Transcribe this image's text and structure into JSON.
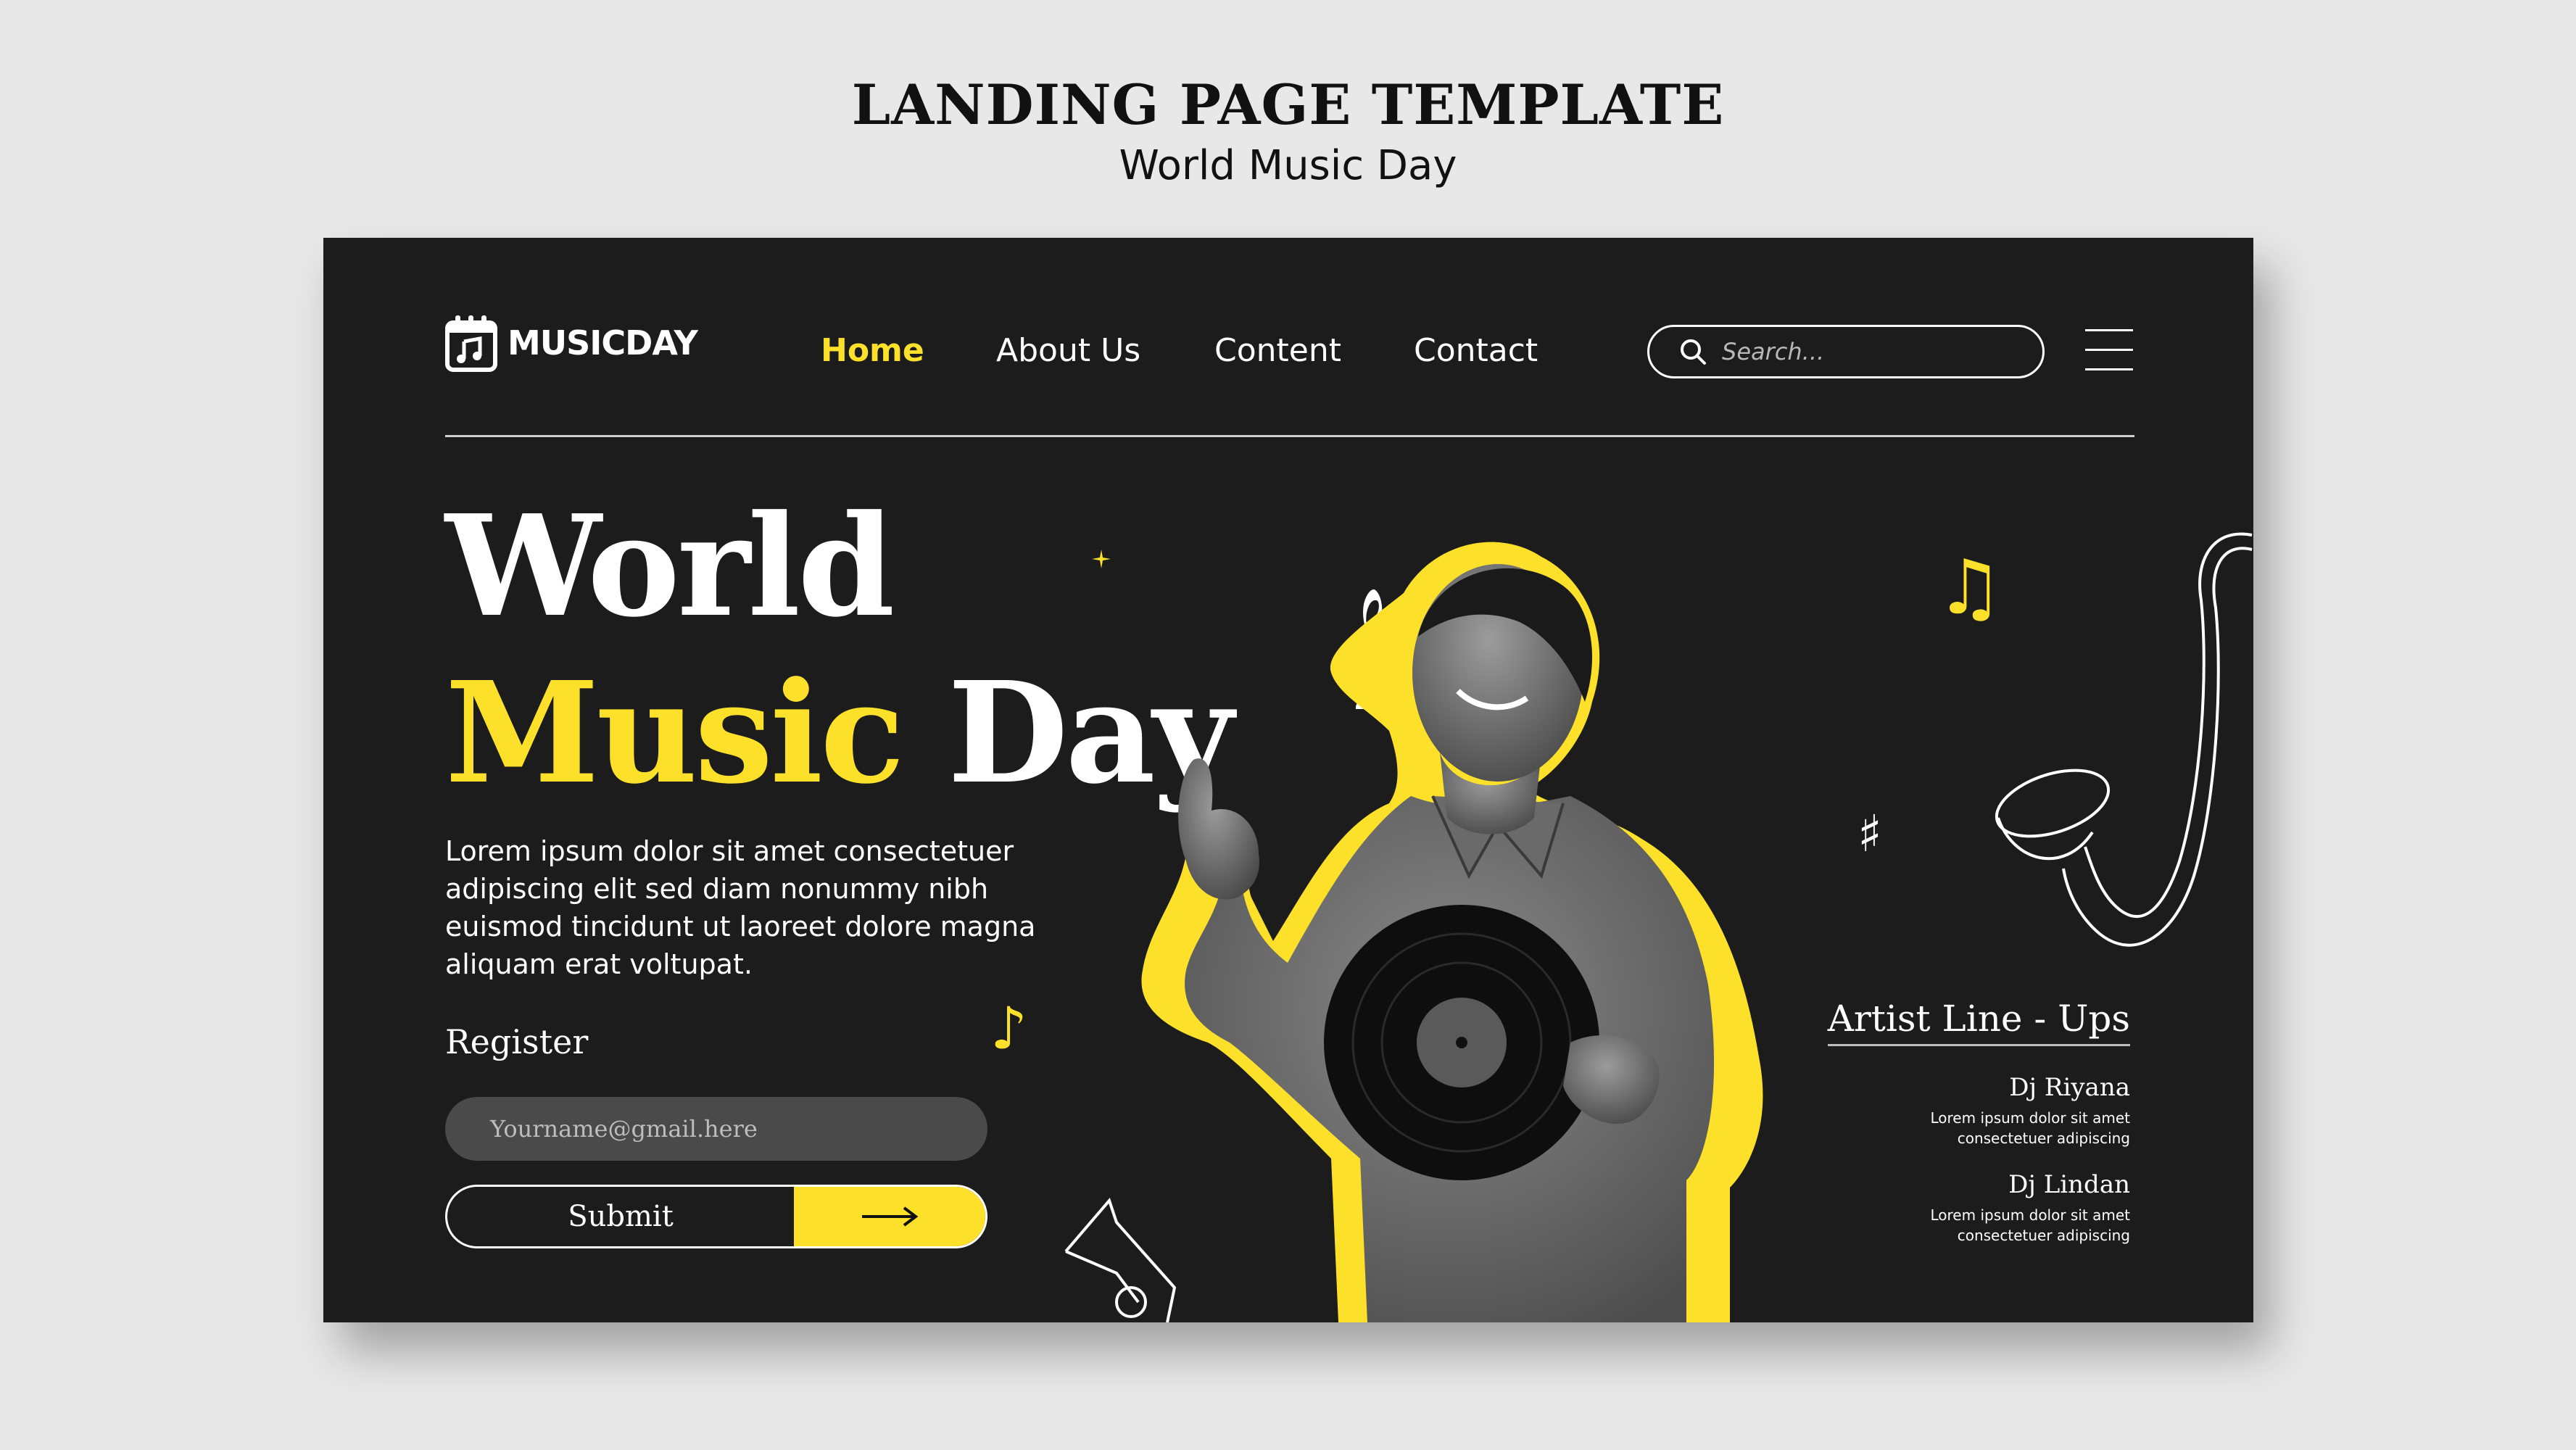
{
  "header": {
    "title": "LANDING PAGE TEMPLATE",
    "subtitle": "World Music Day"
  },
  "brand": {
    "logo_text": "MUSICDAY",
    "icon": "calendar-music-icon"
  },
  "nav": {
    "items": [
      {
        "label": "Home",
        "active": true
      },
      {
        "label": "About Us"
      },
      {
        "label": "Content"
      },
      {
        "label": "Contact"
      }
    ]
  },
  "search": {
    "placeholder": "Search..."
  },
  "hero": {
    "line1": "World",
    "line2_highlight": "Music",
    "line2_rest": "Day",
    "lead": "Lorem ipsum dolor sit amet consectetuer adipiscing elit sed diam nonummy nibh euismod tincidunt ut laoreet dolore magna aliquam erat voltupat."
  },
  "register": {
    "label": "Register",
    "email_placeholder": "Yourname@gmail.here",
    "submit_label": "Submit"
  },
  "artists": {
    "title": "Artist Line - Ups",
    "items": [
      {
        "name": "Dj Riyana",
        "desc": "Lorem ipsum dolor sit amet consectetuer adipiscing"
      },
      {
        "name": "Dj Lindan",
        "desc": "Lorem ipsum dolor sit amet consectetuer adipiscing"
      }
    ]
  },
  "colors": {
    "accent": "#fde02a",
    "background": "#1c1c1c",
    "page": "#e8e8e8"
  }
}
